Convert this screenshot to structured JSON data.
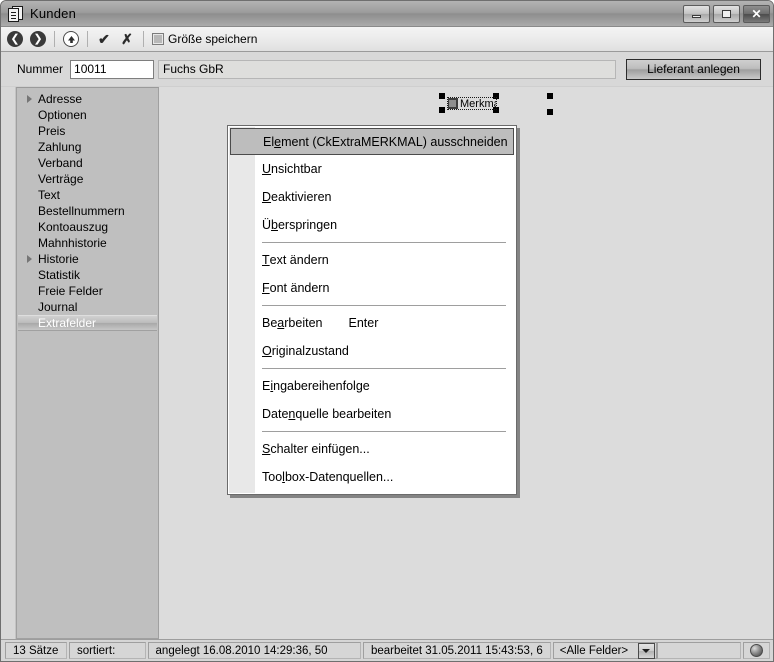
{
  "window": {
    "title": "Kunden",
    "icon": "document-stack-icon",
    "buttons": {
      "minimize": "minimize-button",
      "maximize": "maximize-button",
      "close": "close-button",
      "close_glyph": "✕"
    }
  },
  "toolbar": {
    "back_icon": "back-arrow-icon",
    "back_glyph": "❮",
    "forward_icon": "forward-arrow-icon",
    "forward_glyph": "❯",
    "up_icon": "up-arrow-icon",
    "up_glyph": "❮",
    "confirm_icon": "checkmark-icon",
    "confirm_glyph": "✔",
    "cancel_icon": "cross-icon",
    "cancel_glyph": "✗",
    "save_size_label": "Größe speichern",
    "save_size_checked": false
  },
  "header": {
    "nummer_label": "Nummer",
    "nummer_value": "10011",
    "nummer_placeholder": "",
    "name_value": "Fuchs GbR",
    "name_placeholder": "",
    "create_supplier_label": "Lieferant anlegen"
  },
  "tree": {
    "items": [
      {
        "label": "Adresse",
        "expandable": true,
        "selected": false
      },
      {
        "label": "Optionen",
        "expandable": false,
        "selected": false
      },
      {
        "label": "Preis",
        "expandable": false,
        "selected": false
      },
      {
        "label": "Zahlung",
        "expandable": false,
        "selected": false
      },
      {
        "label": "Verband",
        "expandable": false,
        "selected": false
      },
      {
        "label": "Verträge",
        "expandable": false,
        "selected": false
      },
      {
        "label": "Text",
        "expandable": false,
        "selected": false
      },
      {
        "label": "Bestellnummern",
        "expandable": false,
        "selected": false
      },
      {
        "label": "Kontoauszug",
        "expandable": false,
        "selected": false
      },
      {
        "label": "Mahnhistorie",
        "expandable": false,
        "selected": false
      },
      {
        "label": "Historie",
        "expandable": true,
        "selected": false
      },
      {
        "label": "Statistik",
        "expandable": false,
        "selected": false
      },
      {
        "label": "Freie Felder",
        "expandable": false,
        "selected": false
      },
      {
        "label": "Journal",
        "expandable": false,
        "selected": false
      },
      {
        "label": "Extrafelder",
        "expandable": false,
        "selected": true
      }
    ]
  },
  "canvas": {
    "selected_element_label": "Merkmal",
    "selected_element_type": "checkbox"
  },
  "context_menu": {
    "items": [
      {
        "pre": "El",
        "accel": "e",
        "post": "ment (CkExtraMERKMAL) ausschneiden",
        "shortcut": "",
        "highlight": true,
        "separator_after": false
      },
      {
        "pre": "",
        "accel": "U",
        "post": "nsichtbar",
        "shortcut": "",
        "highlight": false,
        "separator_after": false
      },
      {
        "pre": "",
        "accel": "D",
        "post": "eaktivieren",
        "shortcut": "",
        "highlight": false,
        "separator_after": false
      },
      {
        "pre": "Ü",
        "accel": "b",
        "post": "erspringen",
        "shortcut": "",
        "highlight": false,
        "separator_after": true
      },
      {
        "pre": "",
        "accel": "T",
        "post": "ext ändern",
        "shortcut": "",
        "highlight": false,
        "separator_after": false
      },
      {
        "pre": "",
        "accel": "F",
        "post": "ont ändern",
        "shortcut": "",
        "highlight": false,
        "separator_after": true
      },
      {
        "pre": "Be",
        "accel": "a",
        "post": "rbeiten",
        "shortcut": "Enter",
        "highlight": false,
        "separator_after": false
      },
      {
        "pre": "",
        "accel": "O",
        "post": "riginalzustand",
        "shortcut": "",
        "highlight": false,
        "separator_after": true
      },
      {
        "pre": "E",
        "accel": "i",
        "post": "ngabereihenfolge",
        "shortcut": "",
        "highlight": false,
        "separator_after": false
      },
      {
        "pre": "Date",
        "accel": "n",
        "post": "quelle bearbeiten",
        "shortcut": "",
        "highlight": false,
        "separator_after": true
      },
      {
        "pre": "",
        "accel": "S",
        "post": "chalter einfügen...",
        "shortcut": "",
        "highlight": false,
        "separator_after": false
      },
      {
        "pre": "Too",
        "accel": "l",
        "post": "box-Datenquellen...",
        "shortcut": "",
        "highlight": false,
        "separator_after": false
      }
    ]
  },
  "statusbar": {
    "record_count": "13 Sätze",
    "sorted_label": "sortiert:",
    "created": "angelegt 16.08.2010 14:29:36, 50",
    "edited": "bearbeitet 31.05.2011 15:43:53, 6",
    "field_filter_value": "<Alle Felder>",
    "globe_icon": "globe-icon"
  },
  "colors": {
    "window_bg": "#d4d0c8",
    "canvas_bg": "#dcdcdc",
    "tree_bg": "#bfbfbf",
    "menu_bg": "#ffffff",
    "menu_highlight": "#bdbdbd",
    "statusbar_bg": "#d6d6d6"
  }
}
